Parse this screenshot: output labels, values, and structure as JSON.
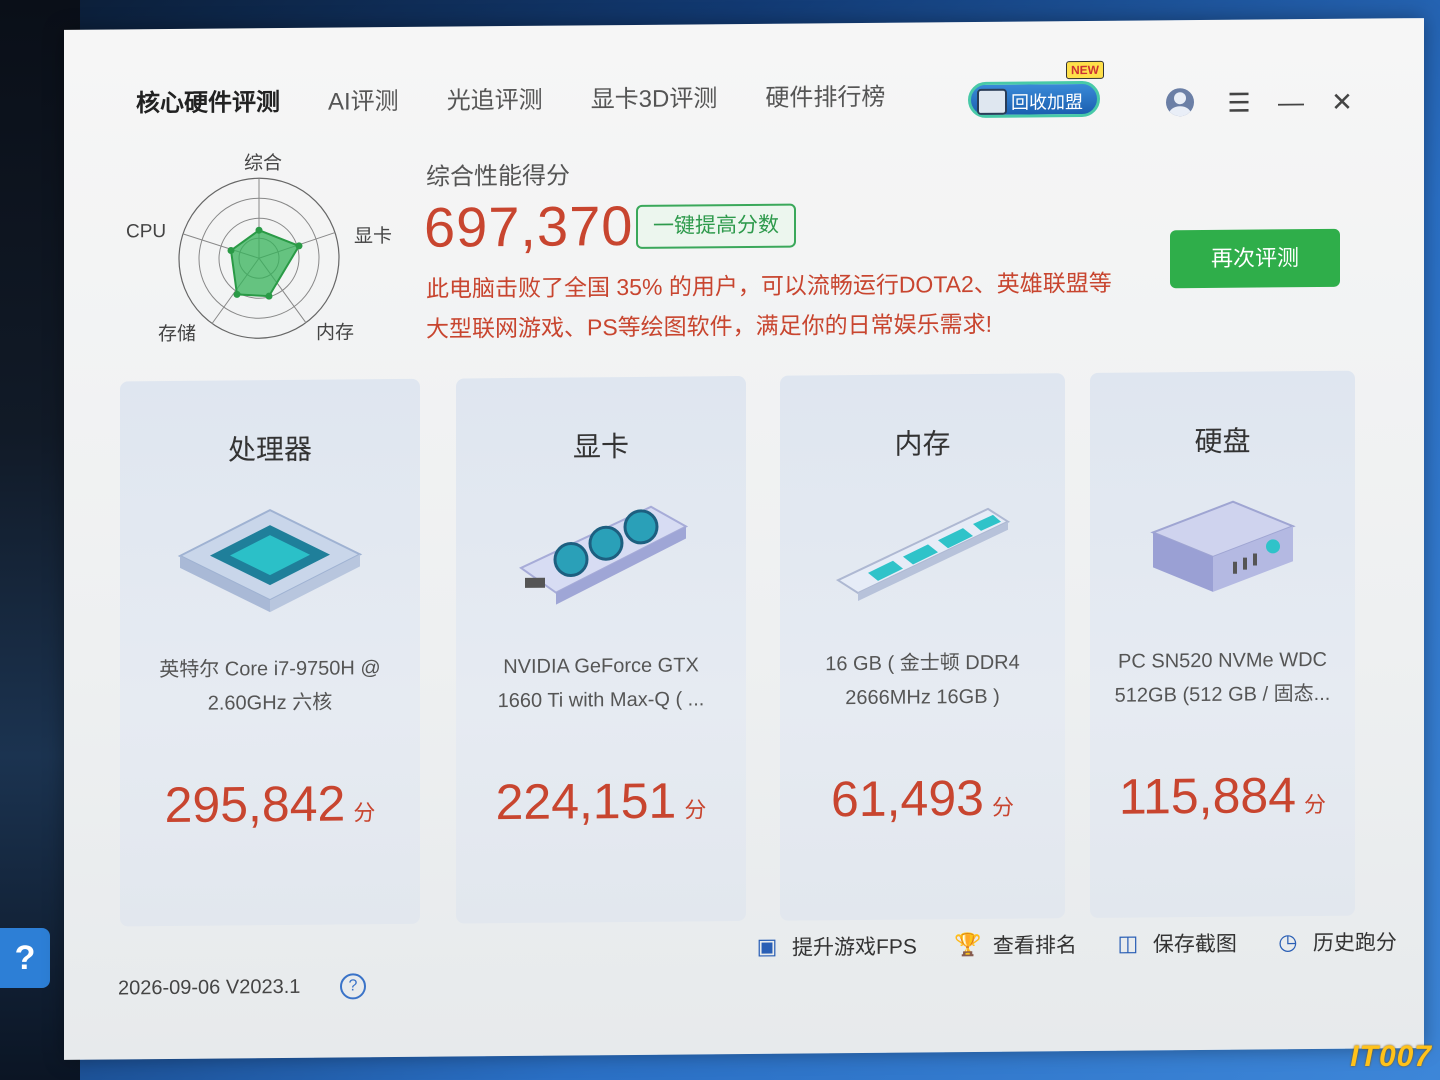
{
  "nav": {
    "tabs": [
      "核心硬件评测",
      "AI评测",
      "光追评测",
      "显卡3D评测",
      "硬件排行榜"
    ],
    "active_index": 0,
    "promo_label": "回收加盟",
    "promo_badge": "NEW"
  },
  "radar": {
    "labels": {
      "top": "综合",
      "left": "CPU",
      "right": "显卡",
      "bottom_left": "存储",
      "bottom_right": "内存"
    },
    "accent_color": "#36b35a"
  },
  "summary": {
    "title": "综合性能得分",
    "score": "697,370",
    "boost_label": "一键提高分数",
    "description": "此电脑击败了全国 35% 的用户，可以流畅运行DOTA2、英雄联盟等大型联网游戏、PS等绘图软件，满足你的日常娱乐需求!",
    "retest_label": "再次评测"
  },
  "cards": [
    {
      "title": "处理器",
      "desc_line1": "英特尔 Core i7-9750H @",
      "desc_line2": "2.60GHz 六核",
      "score": "295,842",
      "unit": "分"
    },
    {
      "title": "显卡",
      "desc_line1": "NVIDIA GeForce GTX",
      "desc_line2": "1660 Ti with Max-Q ( ...",
      "score": "224,151",
      "unit": "分"
    },
    {
      "title": "内存",
      "desc_line1": "16 GB ( 金士顿 DDR4",
      "desc_line2": "2666MHz 16GB )",
      "score": "61,493",
      "unit": "分"
    },
    {
      "title": "硬盘",
      "desc_line1": "PC SN520 NVMe WDC",
      "desc_line2": "512GB (512 GB / 固态...",
      "score": "115,884",
      "unit": "分"
    }
  ],
  "footer": {
    "version": "2026-09-06 V2023.1",
    "actions": [
      "提升游戏FPS",
      "查看排名",
      "保存截图",
      "历史跑分"
    ]
  },
  "watermark": "IT007"
}
